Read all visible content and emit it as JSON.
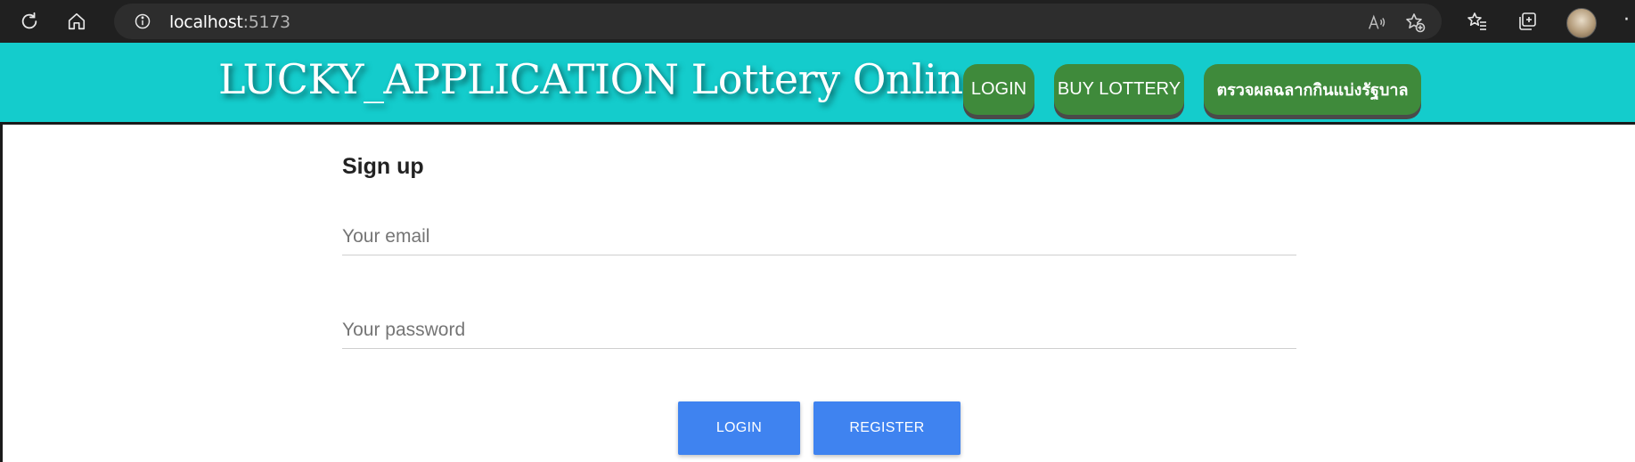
{
  "browser": {
    "url_host": "localhost",
    "url_port": ":5173"
  },
  "header": {
    "title": "LUCKY_APPLICATION Lottery Online",
    "nav": {
      "login": "LOGIN",
      "buy_lottery": "BUY LOTTERY",
      "check_results": "ตรวจผลฉลากกินแบ่งรัฐบาล"
    },
    "colors": {
      "background": "#14cccc",
      "nav_button": "#3f8a3b"
    }
  },
  "form": {
    "title": "Sign up",
    "email_placeholder": "Your email",
    "password_placeholder": "Your password",
    "login_label": "LOGIN",
    "register_label": "REGISTER",
    "button_color": "#3f83f0"
  },
  "icons": {
    "refresh": "refresh-icon",
    "home": "home-icon",
    "site_info": "info-icon",
    "read_aloud": "read-aloud-icon",
    "add_favorite": "add-favorite-icon",
    "favorites": "favorites-icon",
    "collections": "collections-icon",
    "profile": "profile-avatar",
    "more": "more-icon"
  }
}
